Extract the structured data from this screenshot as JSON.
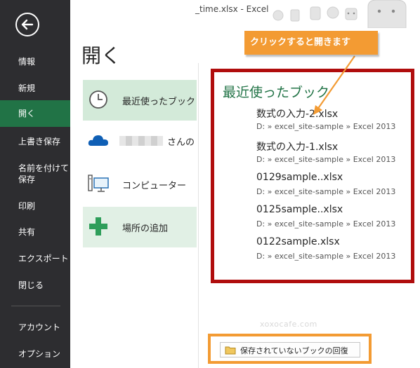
{
  "window": {
    "title": "_time.xlsx - Excel"
  },
  "sidebar": {
    "back_icon": "back-arrow-icon",
    "items": [
      {
        "label": "情報"
      },
      {
        "label": "新規"
      },
      {
        "label": "開く",
        "active": true
      },
      {
        "label": "上書き保存"
      },
      {
        "label": "名前を付けて\n保存"
      },
      {
        "label": "印刷"
      },
      {
        "label": "共有"
      },
      {
        "label": "エクスポート"
      },
      {
        "label": "閉じる"
      },
      {
        "label": "アカウント"
      },
      {
        "label": "オプション"
      }
    ]
  },
  "main": {
    "title": "開く",
    "locations": [
      {
        "label": "最近使ったブック",
        "icon": "clock-icon",
        "selected": true
      },
      {
        "label": "さんの",
        "icon": "onedrive-cloud-icon"
      },
      {
        "label": "コンピューター",
        "icon": "computer-icon"
      },
      {
        "label": "場所の追加",
        "icon": "plus-icon"
      }
    ],
    "recent": {
      "heading": "最近使ったブック",
      "files": [
        {
          "name": "数式の入力-2.xlsx",
          "path": "D: » excel_site-sample » Excel 2013"
        },
        {
          "name": "数式の入力-1.xlsx",
          "path": "D: » excel_site-sample » Excel 2013"
        },
        {
          "name": "0129sample..xlsx",
          "path": "D: » excel_site-sample » Excel 2013"
        },
        {
          "name": "0125sample..xlsx",
          "path": "D: » excel_site-sample » Excel 2013"
        },
        {
          "name": "0122sample.xlsx",
          "path": "D: » excel_site-sample » Excel 2013"
        }
      ]
    },
    "recover_button": "保存されていないブックの回復",
    "watermark": "xoxocafe.com"
  },
  "annotation": {
    "callout": "クリックすると開きます"
  },
  "colors": {
    "accent": "#217346",
    "sidebar_bg": "#2d2d30",
    "callout": "#f39b33",
    "highlight_border": "#b00d0d"
  }
}
